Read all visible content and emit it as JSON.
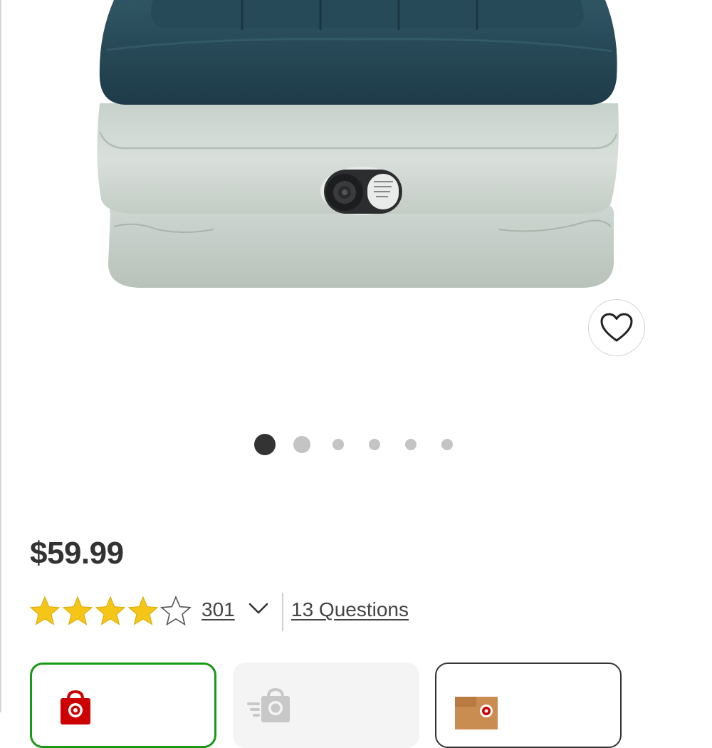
{
  "product": {
    "image_alt": "Air mattress",
    "price": "$59.99",
    "rating": 4,
    "rating_max": 5,
    "review_count": "301",
    "questions_label": "13 Questions"
  },
  "carousel": {
    "total_images": 6,
    "active_index": 0
  },
  "fulfillment": {
    "selected": "pickup"
  },
  "icons": {
    "favorite": "heart-outline-icon",
    "expand_reviews": "chevron-down-icon",
    "pickup": "store-bag-icon",
    "same_day": "fast-bag-icon",
    "shipping": "box-icon"
  },
  "colors": {
    "price_text": "#333333",
    "star_fill": "#f5c518",
    "selected_border": "#179a17",
    "brand_red": "#cc0000",
    "dot_active": "#333333",
    "dot_inactive": "#c4c4c4"
  }
}
